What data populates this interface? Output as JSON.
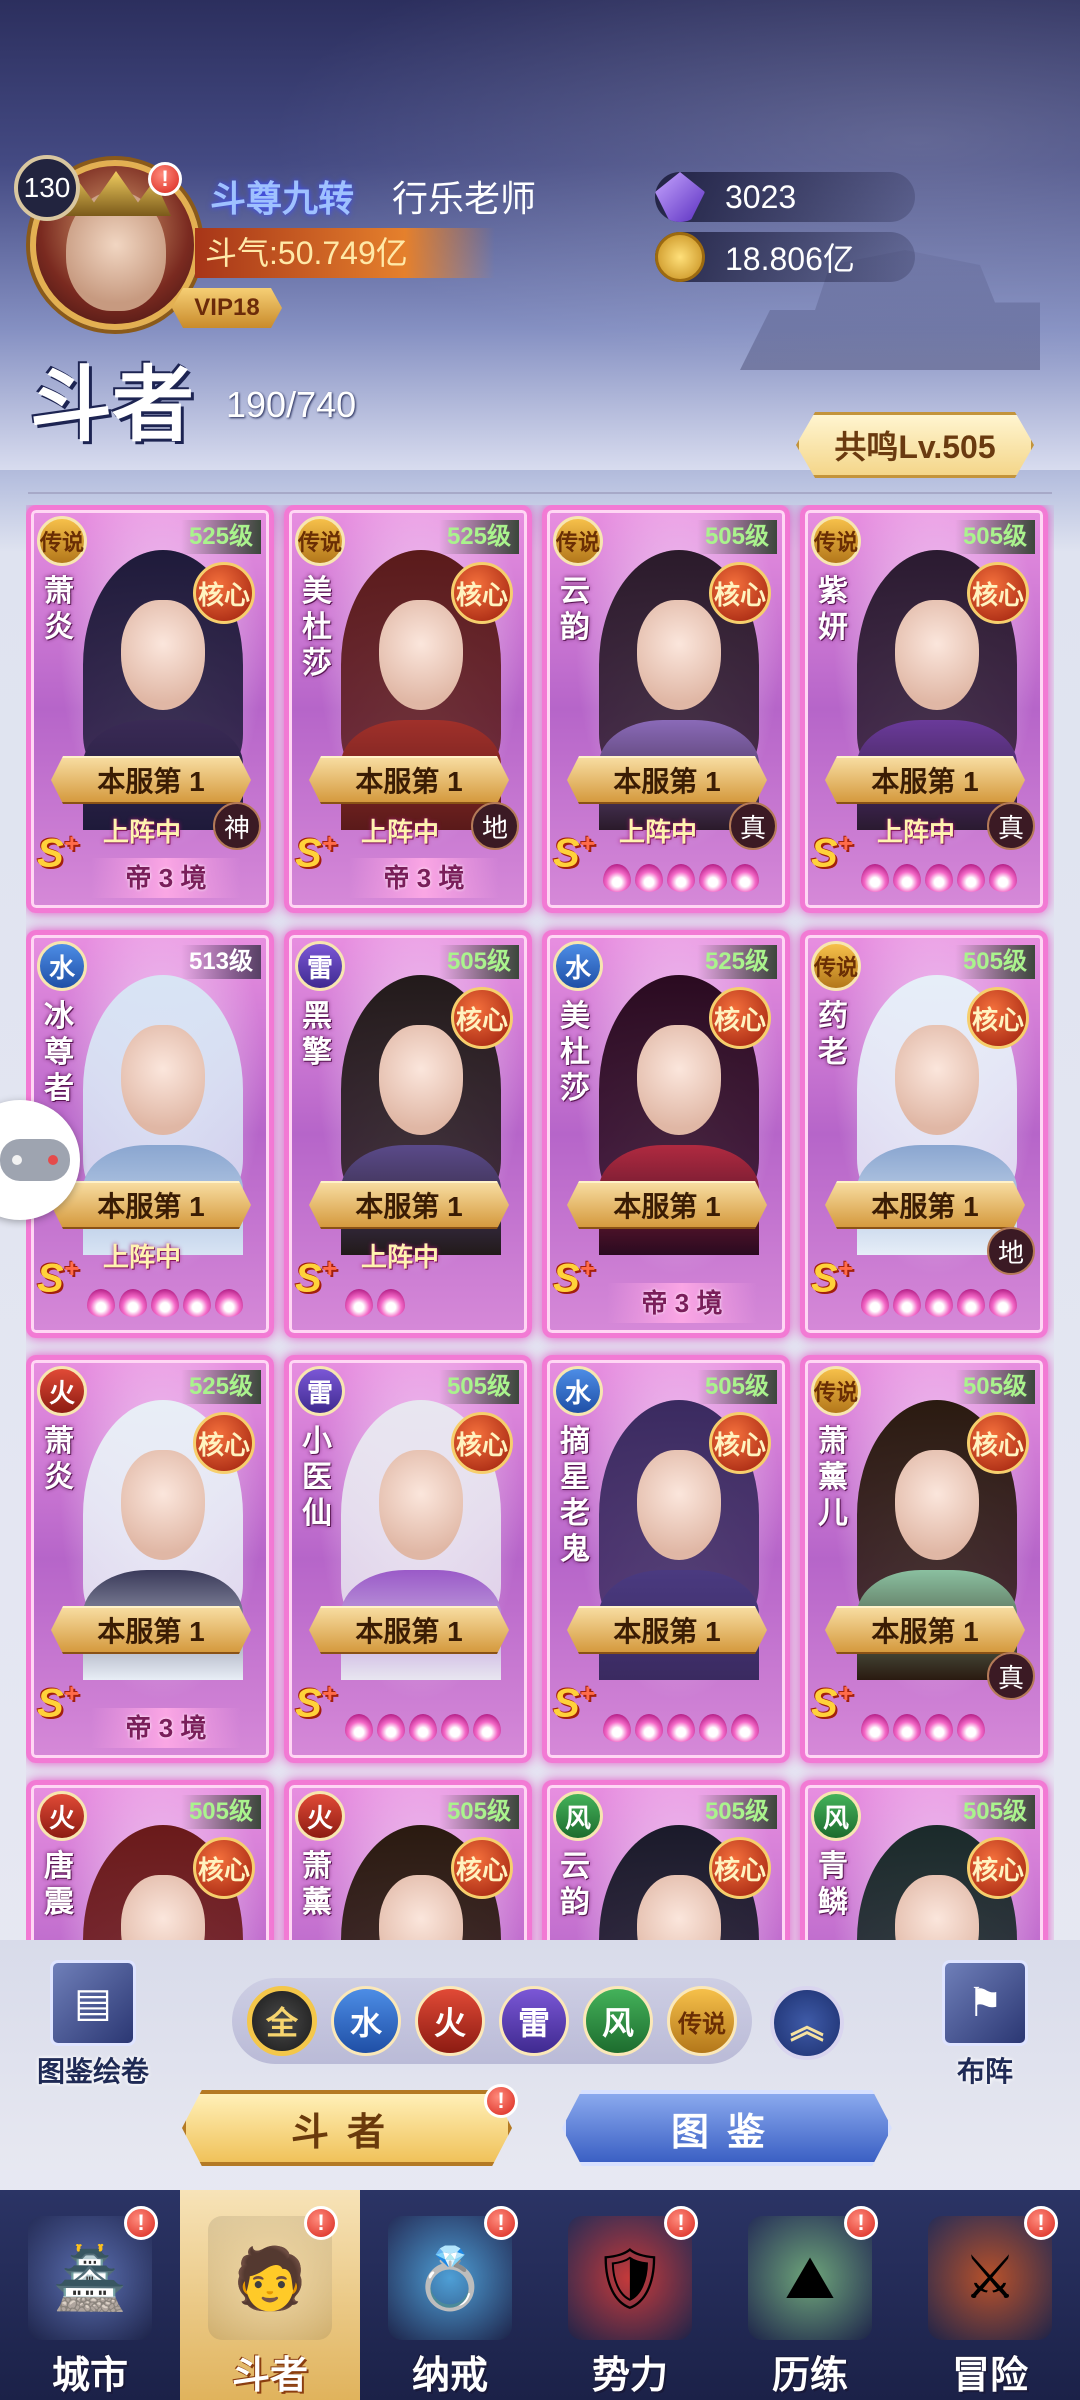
{
  "header": {
    "player_level": "130",
    "title": "斗尊九转",
    "name": "行乐老师",
    "power": "斗气:50.749亿",
    "vip": "VIP18",
    "gems": "3023",
    "gold": "18.806亿",
    "alert": "!"
  },
  "section": {
    "title": "斗者",
    "count": "190/740",
    "resonance": "共鸣Lv.505"
  },
  "cards": [
    {
      "name": "萧炎",
      "element": "传说",
      "el": "legend",
      "level": "525级",
      "core": "核心",
      "rank": "本服第 1",
      "deployed": "上阵中",
      "grade": "神",
      "realm": "帝 3 境",
      "flames": 0
    },
    {
      "name": "美杜莎",
      "element": "传说",
      "el": "legend",
      "level": "525级",
      "core": "核心",
      "rank": "本服第 1",
      "deployed": "上阵中",
      "grade": "地",
      "realm": "帝 3 境",
      "flames": 0
    },
    {
      "name": "云韵",
      "element": "传说",
      "el": "legend",
      "level": "505级",
      "core": "核心",
      "rank": "本服第 1",
      "deployed": "上阵中",
      "grade": "真",
      "realm": "",
      "flames": 5
    },
    {
      "name": "紫妍",
      "element": "传说",
      "el": "legend",
      "level": "505级",
      "core": "核心",
      "rank": "本服第 1",
      "deployed": "上阵中",
      "grade": "真",
      "realm": "",
      "flames": 5
    },
    {
      "name": "冰尊者",
      "element": "水",
      "el": "water",
      "level": "513级",
      "core": "",
      "rank": "本服第 1",
      "deployed": "上阵中",
      "grade": "",
      "realm": "",
      "flames": 5
    },
    {
      "name": "黑擎",
      "element": "雷",
      "el": "thunder",
      "level": "505级",
      "core": "核心",
      "rank": "本服第 1",
      "deployed": "上阵中",
      "grade": "",
      "realm": "",
      "flames": 2
    },
    {
      "name": "美杜莎",
      "element": "水",
      "el": "water",
      "level": "525级",
      "core": "核心",
      "rank": "本服第 1",
      "deployed": "",
      "grade": "",
      "realm": "帝 3 境",
      "flames": 0
    },
    {
      "name": "药老",
      "element": "传说",
      "el": "legend",
      "level": "505级",
      "core": "核心",
      "rank": "本服第 1",
      "deployed": "",
      "grade": "地",
      "realm": "",
      "flames": 5
    },
    {
      "name": "萧炎",
      "element": "火",
      "el": "fire",
      "level": "525级",
      "core": "核心",
      "rank": "本服第 1",
      "deployed": "",
      "grade": "",
      "realm": "帝 3 境",
      "flames": 0
    },
    {
      "name": "小医仙",
      "element": "雷",
      "el": "thunder",
      "level": "505级",
      "core": "核心",
      "rank": "本服第 1",
      "deployed": "",
      "grade": "",
      "realm": "",
      "flames": 5
    },
    {
      "name": "摘星老鬼",
      "element": "水",
      "el": "water",
      "level": "505级",
      "core": "核心",
      "rank": "本服第 1",
      "deployed": "",
      "grade": "",
      "realm": "",
      "flames": 5
    },
    {
      "name": "萧薰儿",
      "element": "传说",
      "el": "legend",
      "level": "505级",
      "core": "核心",
      "rank": "本服第 1",
      "deployed": "",
      "grade": "真",
      "realm": "",
      "flames": 4
    },
    {
      "name": "唐震",
      "element": "火",
      "el": "fire",
      "level": "505级",
      "core": "核心",
      "rank": "",
      "deployed": "",
      "grade": "",
      "realm": "",
      "flames": 0
    },
    {
      "name": "萧薰",
      "element": "火",
      "el": "fire",
      "level": "505级",
      "core": "核心",
      "rank": "",
      "deployed": "",
      "grade": "",
      "realm": "",
      "flames": 0
    },
    {
      "name": "云韵",
      "element": "风",
      "el": "wind",
      "level": "505级",
      "core": "核心",
      "rank": "",
      "deployed": "",
      "grade": "",
      "realm": "",
      "flames": 0
    },
    {
      "name": "青鳞",
      "element": "风",
      "el": "wind",
      "level": "505级",
      "core": "核心",
      "rank": "",
      "deployed": "",
      "grade": "",
      "realm": "",
      "flames": 0
    }
  ],
  "splus": "S",
  "filters": {
    "left_button": "图鉴绘卷",
    "right_button": "布阵",
    "chips": [
      {
        "label": "全",
        "cls": "chip-all"
      },
      {
        "label": "水",
        "cls": "el-water"
      },
      {
        "label": "火",
        "cls": "el-fire"
      },
      {
        "label": "雷",
        "cls": "el-thunder"
      },
      {
        "label": "风",
        "cls": "el-wind"
      },
      {
        "label": "传说",
        "cls": "chip-legend"
      }
    ],
    "collapse": "︽"
  },
  "buttons": {
    "fighters": "斗者",
    "gallery": "图鉴"
  },
  "nav": [
    {
      "label": "城市",
      "icon": "city-icon",
      "glyph": "🏯",
      "active": false
    },
    {
      "label": "斗者",
      "icon": "fighter-icon",
      "glyph": "🧑",
      "active": true
    },
    {
      "label": "纳戒",
      "icon": "ring-icon",
      "glyph": "💍",
      "active": false
    },
    {
      "label": "势力",
      "icon": "faction-icon",
      "glyph": "🛡",
      "active": false
    },
    {
      "label": "历练",
      "icon": "training-icon",
      "glyph": "⛰",
      "active": false
    },
    {
      "label": "冒险",
      "icon": "adventure-icon",
      "glyph": "⚔",
      "active": false
    }
  ],
  "colors": {
    "card_border": "#f27ad4",
    "accent_gold": "#f0c25a"
  }
}
